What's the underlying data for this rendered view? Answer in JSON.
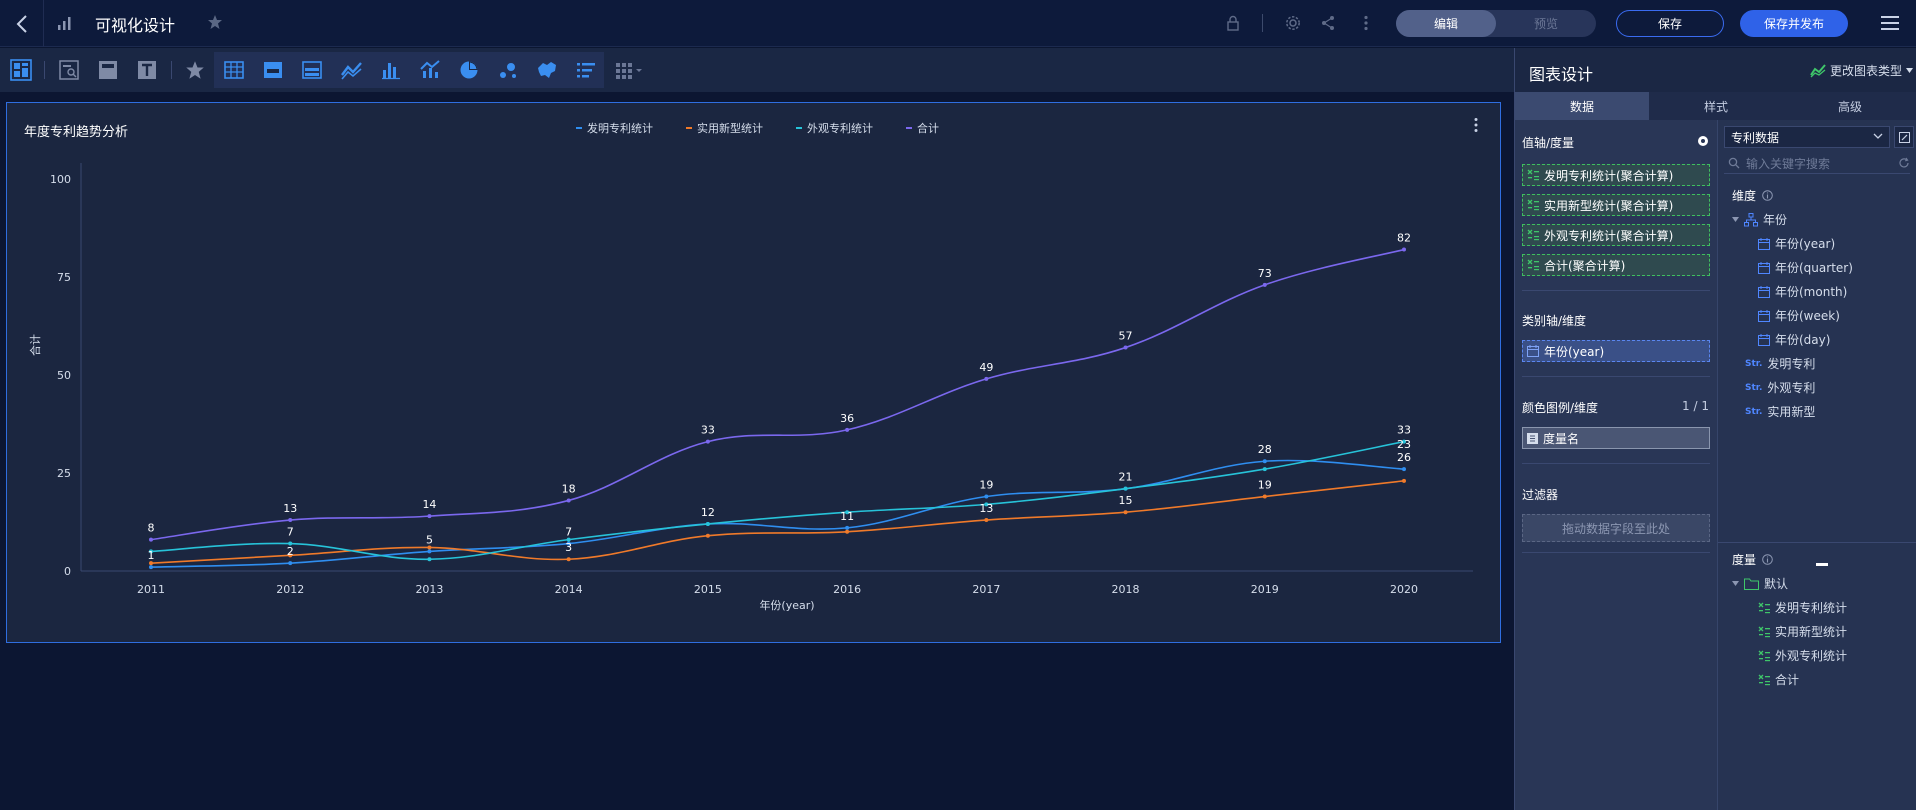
{
  "topbar": {
    "title": "可视化设计",
    "mode_edit": "编辑",
    "mode_preview": "预览",
    "save": "保存",
    "save_publish": "保存并发布"
  },
  "chart": {
    "title": "年度专利趋势分析",
    "ylabel": "合计",
    "xlabel": "年份(year)"
  },
  "chart_data": {
    "type": "line",
    "categories": [
      "2011",
      "2012",
      "2013",
      "2014",
      "2015",
      "2016",
      "2017",
      "2018",
      "2019",
      "2020"
    ],
    "series": [
      {
        "name": "发明专利统计",
        "color": "#2f8ef0",
        "values": [
          1,
          2,
          5,
          7,
          12,
          11,
          19,
          21,
          28,
          26
        ]
      },
      {
        "name": "实用新型统计",
        "color": "#f07a2a",
        "values": [
          2,
          4,
          6,
          3,
          9,
          10,
          13,
          15,
          19,
          23
        ]
      },
      {
        "name": "外观专利统计",
        "color": "#27c3d9",
        "values": [
          5,
          7,
          3,
          8,
          12,
          15,
          17,
          21,
          26,
          33
        ]
      },
      {
        "name": "合计",
        "color": "#7b68ee",
        "values": [
          8,
          13,
          14,
          18,
          33,
          36,
          49,
          57,
          73,
          82
        ]
      }
    ],
    "data_labels": [
      {
        "category": "2011",
        "texts": [
          "8",
          "1"
        ]
      },
      {
        "category": "2012",
        "texts": [
          "13",
          "7",
          "2"
        ]
      },
      {
        "category": "2013",
        "texts": [
          "14",
          "5"
        ]
      },
      {
        "category": "2014",
        "texts": [
          "18",
          "7",
          "3"
        ]
      },
      {
        "category": "2015",
        "texts": [
          "33",
          "12"
        ]
      },
      {
        "category": "2016",
        "texts": [
          "36",
          "11"
        ]
      },
      {
        "category": "2017",
        "texts": [
          "49",
          "19",
          "13"
        ]
      },
      {
        "category": "2018",
        "texts": [
          "57",
          "21",
          "15"
        ]
      },
      {
        "category": "2019",
        "texts": [
          "73",
          "28",
          "19"
        ]
      },
      {
        "category": "2020",
        "texts": [
          "82",
          "33",
          "26",
          "23"
        ]
      }
    ],
    "yticks": [
      "0",
      "25",
      "50",
      "75",
      "100"
    ],
    "ylim": [
      0,
      100
    ],
    "legend_position": "top-center",
    "grid": false
  },
  "panel": {
    "title": "图表设计",
    "change_type": "更改图表类型",
    "tabs": [
      "数据",
      "样式",
      "高级"
    ],
    "value_axis": {
      "title": "值轴/度量",
      "fields": [
        "发明专利统计(聚合计算)",
        "实用新型统计(聚合计算)",
        "外观专利统计(聚合计算)",
        "合计(聚合计算)"
      ]
    },
    "category_axis": {
      "title": "类别轴/维度",
      "field": "年份(year)"
    },
    "color_legend": {
      "title": "颜色图例/维度",
      "count": "1 / 1",
      "field": "度量名"
    },
    "filter": {
      "title": "过滤器",
      "placeholder": "拖动数据字段至此处"
    },
    "dataset": {
      "name": "专利数据",
      "search_placeholder": "输入关键字搜索",
      "dimension_title": "维度",
      "dim_group": "年份",
      "dim_date_items": [
        "年份(year)",
        "年份(quarter)",
        "年份(month)",
        "年份(week)",
        "年份(day)"
      ],
      "dim_str_items": [
        "发明专利",
        "外观专利",
        "实用新型"
      ],
      "str_tag": "Str.",
      "measure_title": "度量",
      "measure_folder": "默认",
      "measure_items": [
        "发明专利统计",
        "实用新型统计",
        "外观专利统计",
        "合计"
      ]
    }
  }
}
